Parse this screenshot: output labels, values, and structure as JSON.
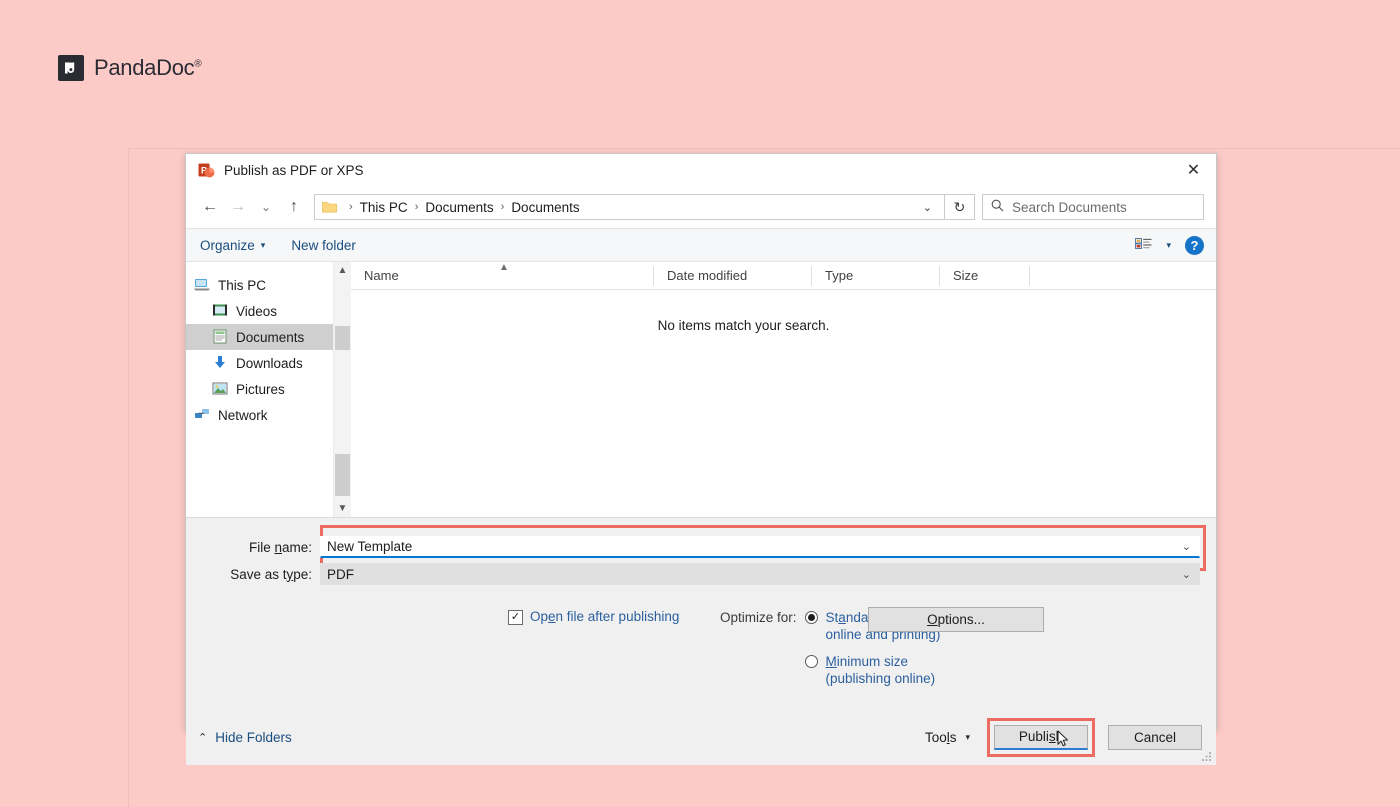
{
  "brand": {
    "mark": "pandadoc-logo-mark",
    "name": "PandaDoc",
    "trademark": "®"
  },
  "dialog": {
    "title": "Publish as PDF or XPS",
    "app_icon": "powerpoint-icon",
    "close_label": "✕",
    "nav": {
      "back": "←",
      "forward": "→",
      "recent": "⌄",
      "up": "↑",
      "breadcrumb_parts": [
        "This PC",
        "Documents",
        "Documents"
      ],
      "breadcrumb_separator": "›",
      "breadcrumb_caret": "⌄",
      "refresh": "↻",
      "search_placeholder": "Search Documents",
      "search_icon": "search-icon"
    },
    "commandbar": {
      "organize": "Organize",
      "organize_caret": "▾",
      "new_folder": "New folder",
      "view_caret": "▾",
      "help": "?"
    },
    "tree": [
      {
        "label": "This PC",
        "icon": "this-pc-icon",
        "indent": false,
        "selected": false
      },
      {
        "label": "Videos",
        "icon": "videos-icon",
        "indent": true,
        "selected": false
      },
      {
        "label": "Documents",
        "icon": "documents-icon",
        "indent": true,
        "selected": true
      },
      {
        "label": "Downloads",
        "icon": "downloads-icon",
        "indent": true,
        "selected": false
      },
      {
        "label": "Pictures",
        "icon": "pictures-icon",
        "indent": true,
        "selected": false
      },
      {
        "label": "Network",
        "icon": "network-icon",
        "indent": false,
        "selected": false
      }
    ],
    "columns": [
      "Name",
      "Date modified",
      "Type",
      "Size"
    ],
    "empty_message": "No items match your search.",
    "form": {
      "file_name_label_pre": "File ",
      "file_name_label_key": "n",
      "file_name_label_post": "ame:",
      "file_name_value": "New Template",
      "save_as_type_label_pre": "Save as t",
      "save_as_type_label_key": "y",
      "save_as_type_label_post": "pe:",
      "save_as_type_value": "PDF",
      "dropdown_caret": "⌄"
    },
    "options": {
      "open_after_publishing_checked": true,
      "open_after_publishing_pre": "Op",
      "open_after_publishing_key": "e",
      "open_after_publishing_post": "n file after publishing",
      "check_glyph": "✓",
      "optimize_for_label": "Optimize for:",
      "radios": [
        {
          "pre": "St",
          "key": "a",
          "post": "ndard (publishing",
          "line2": "online and printing)",
          "selected": true
        },
        {
          "pre": "",
          "key": "M",
          "post": "inimum size",
          "line2": "(publishing online)",
          "selected": false
        }
      ],
      "options_button_pre": "",
      "options_button_key": "O",
      "options_button_post": "ptions..."
    },
    "footer": {
      "hide_folders": "Hide Folders",
      "hide_folders_chev": "⌃",
      "tools_pre": "Too",
      "tools_key": "l",
      "tools_post": "s",
      "tools_caret": "▾",
      "publish_pre": "Publi",
      "publish_key": "s",
      "publish_post": "h",
      "cancel": "Cancel"
    }
  },
  "colors": {
    "page_background": "#fccbc8",
    "highlight_red": "#eb6a62",
    "accent_blue": "#0078d7",
    "link_blue": "#2b5f9e",
    "help_blue": "#1573c9"
  }
}
